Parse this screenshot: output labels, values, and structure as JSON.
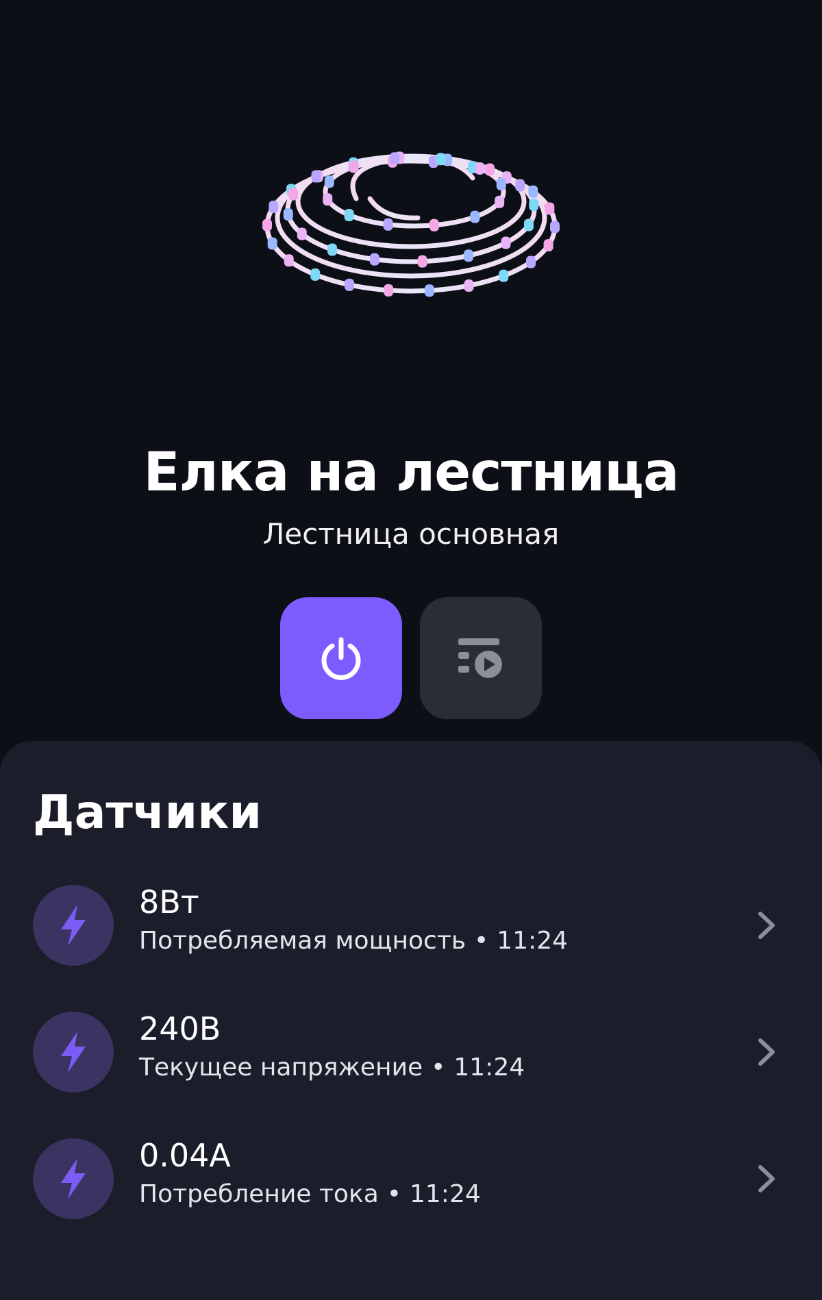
{
  "device": {
    "title": "Елка на лестница",
    "room": "Лестница основная"
  },
  "actions": [
    {
      "name": "power",
      "icon": "power-icon",
      "color": "#7c5cff"
    },
    {
      "name": "scenario",
      "icon": "scenario-play-icon",
      "color": "#2a2c37"
    }
  ],
  "sensors": {
    "title": "Датчики",
    "items": [
      {
        "value": "8Вт",
        "label": "Потребляемая мощность",
        "time": "11:24",
        "icon": "lightning-icon"
      },
      {
        "value": "240В",
        "label": "Текущее напряжение",
        "time": "11:24",
        "icon": "lightning-icon"
      },
      {
        "value": "0.04А",
        "label": "Потребление тока",
        "time": "11:24",
        "icon": "lightning-icon"
      }
    ]
  },
  "colors": {
    "background": "#0d0f17",
    "panel": "#1b1e2a",
    "accent": "#7c5cff",
    "sensor_icon_bg": "#3b3361",
    "sensor_icon": "#7b5cf5"
  }
}
